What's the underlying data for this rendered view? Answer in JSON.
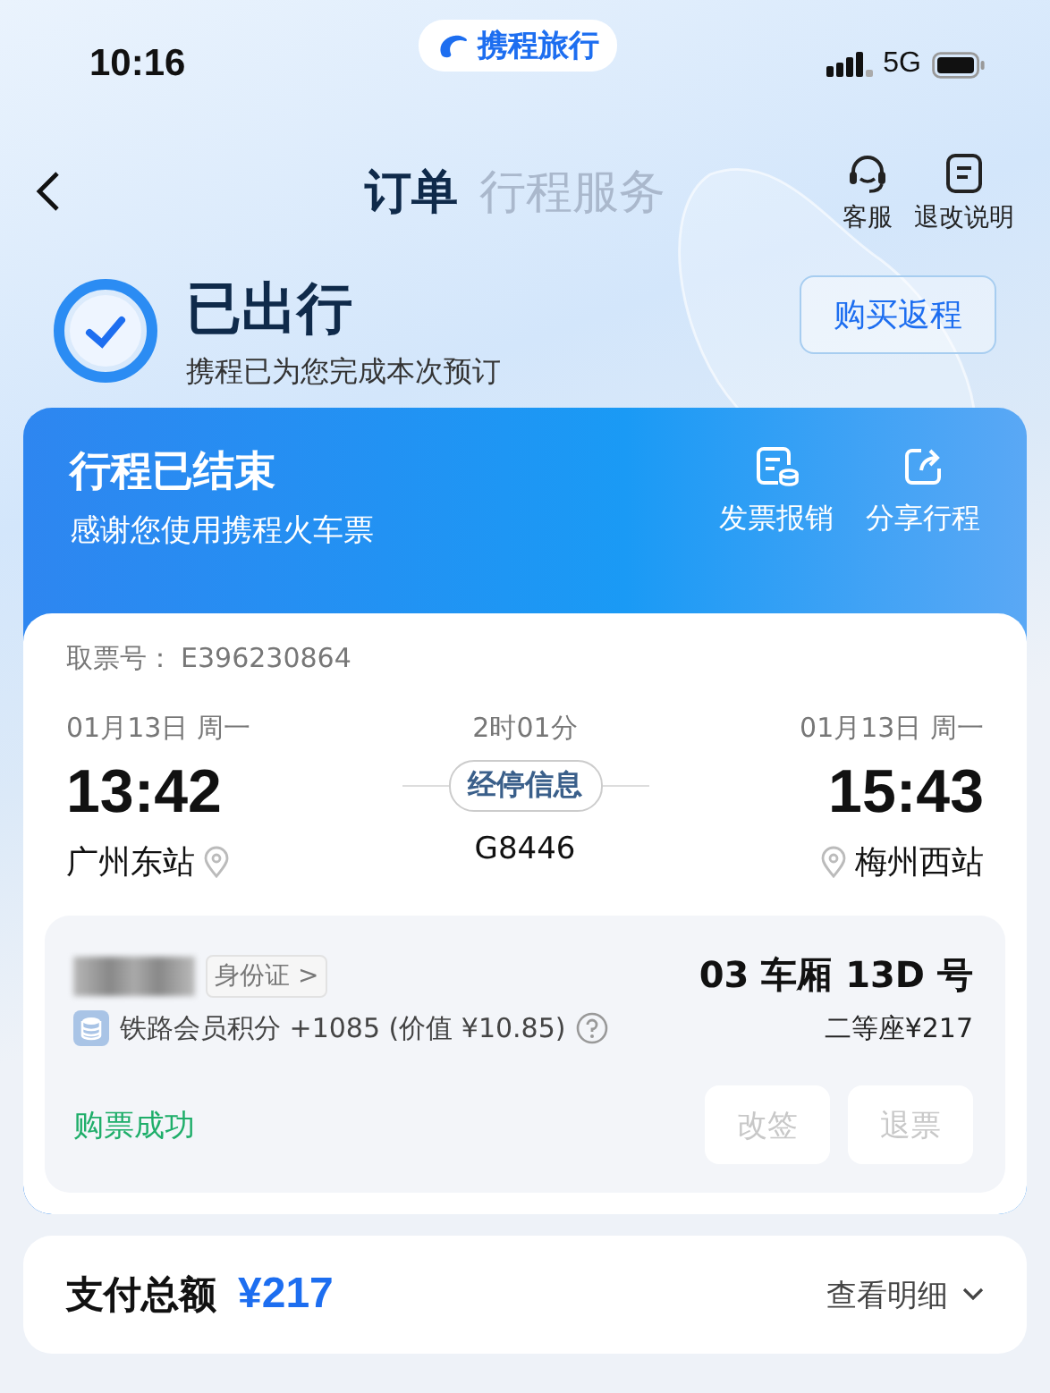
{
  "status_bar": {
    "time": "10:16",
    "network": "5G"
  },
  "app_logo": {
    "text": "携程旅行"
  },
  "nav": {
    "tabs": [
      {
        "label": "订单",
        "selected": true
      },
      {
        "label": "行程服务",
        "selected": false
      }
    ],
    "actions": [
      {
        "label": "客服",
        "kind": "headset"
      },
      {
        "label": "退改说明",
        "kind": "doc"
      }
    ]
  },
  "order_status": {
    "title": "已出行",
    "subtitle": "携程已为您完成本次预订",
    "button": "购买返程"
  },
  "trip_banner": {
    "title": "行程已结束",
    "subtitle": "感谢您使用携程火车票",
    "actions": [
      {
        "label": "发票报销",
        "kind": "invoice"
      },
      {
        "label": "分享行程",
        "kind": "share"
      }
    ]
  },
  "ticket": {
    "pickup_label": "取票号：",
    "pickup_number": "E396230864",
    "departure": {
      "date": "01月13日 周一",
      "time": "13:42",
      "station": "广州东站"
    },
    "arrival": {
      "date": "01月13日 周一",
      "time": "15:43",
      "station": "梅州西站"
    },
    "duration": "2时01分",
    "stops_button": "经停信息",
    "train_number": "G8446"
  },
  "passenger": {
    "id_type": "身份证 >",
    "seat": "03 车厢 13D 号",
    "points": "铁路会员积分 +1085 (价值 ¥10.85)",
    "fare": "二等座¥217",
    "status": "购票成功",
    "buttons": [
      {
        "label": "改签",
        "disabled": true
      },
      {
        "label": "退票",
        "disabled": true
      }
    ]
  },
  "payment": {
    "label": "支付总额",
    "amount": "¥217",
    "details_link": "查看明细"
  }
}
